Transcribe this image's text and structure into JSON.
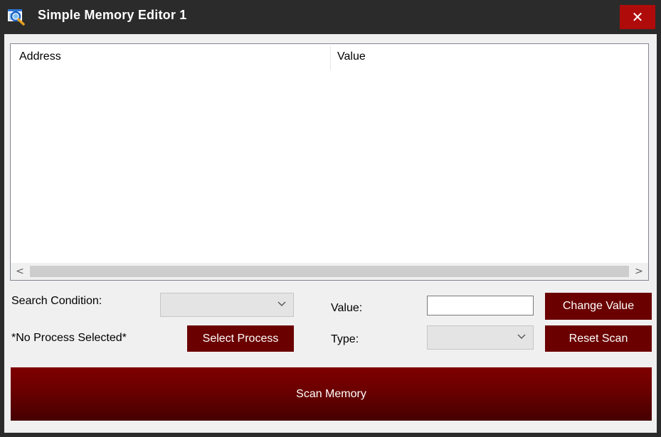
{
  "window": {
    "title": "Simple Memory Editor 1",
    "close_glyph": "✕",
    "app_icon": "magnifier-window-icon"
  },
  "listview": {
    "columns": [
      "Address",
      "Value"
    ],
    "rows": [],
    "scroll_left_glyph": "<",
    "scroll_right_glyph": ">"
  },
  "controls": {
    "search_condition_label": "Search Condition:",
    "search_condition_value": "",
    "value_label": "Value:",
    "value_input": "",
    "change_value_button": "Change Value",
    "process_status": "*No Process Selected*",
    "select_process_button": "Select Process",
    "type_label": "Type:",
    "type_value": "",
    "reset_scan_button": "Reset Scan",
    "scan_memory_button": "Scan Memory"
  },
  "colors": {
    "titlebar": "#2b2b2b",
    "close_button": "#b00b0b",
    "button": "#6b0000",
    "client": "#f0f0f0"
  }
}
